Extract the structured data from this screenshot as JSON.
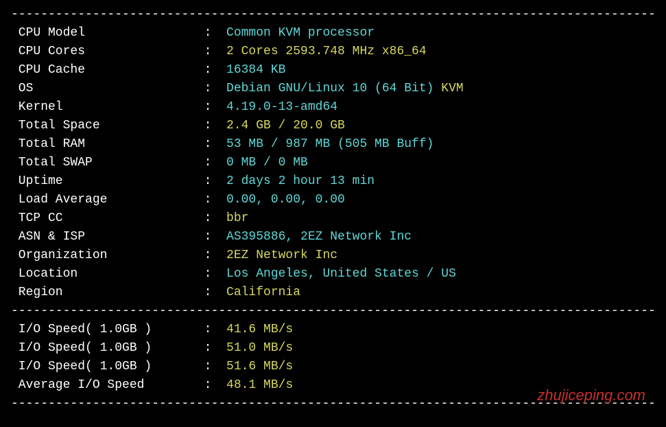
{
  "divider": "----------------------------------------------------------------------------------------------",
  "info": {
    "cpu_model": {
      "label": " CPU Model          ",
      "value": "Common KVM processor",
      "class": "val-cyan"
    },
    "cpu_cores": {
      "label": " CPU Cores          ",
      "value": "2 Cores 2593.748 MHz x86_64",
      "class": "val-yellow"
    },
    "cpu_cache": {
      "label": " CPU Cache          ",
      "value": "16384 KB",
      "class": "val-cyan"
    },
    "os": {
      "label": " OS                 ",
      "value1": "Debian GNU/Linux 10 (64 Bit) ",
      "value2": "KVM",
      "class1": "val-cyan",
      "class2": "val-yellow"
    },
    "kernel": {
      "label": " Kernel             ",
      "value": "4.19.0-13-amd64",
      "class": "val-cyan"
    },
    "total_space": {
      "label": " Total Space        ",
      "value": "2.4 GB / 20.0 GB",
      "class": "val-yellow"
    },
    "total_ram": {
      "label": " Total RAM          ",
      "value": "53 MB / 987 MB (505 MB Buff)",
      "class": "val-cyan"
    },
    "total_swap": {
      "label": " Total SWAP         ",
      "value": "0 MB / 0 MB",
      "class": "val-cyan"
    },
    "uptime": {
      "label": " Uptime             ",
      "value": "2 days 2 hour 13 min",
      "class": "val-cyan"
    },
    "load_avg": {
      "label": " Load Average       ",
      "value": "0.00, 0.00, 0.00",
      "class": "val-cyan"
    },
    "tcp_cc": {
      "label": " TCP CC             ",
      "value": "bbr",
      "class": "val-yellow"
    },
    "asn_isp": {
      "label": " ASN & ISP          ",
      "value": "AS395886, 2EZ Network Inc",
      "class": "val-cyan"
    },
    "organization": {
      "label": " Organization       ",
      "value": "2EZ Network Inc",
      "class": "val-yellow"
    },
    "location": {
      "label": " Location           ",
      "value": "Los Angeles, United States / US",
      "class": "val-cyan"
    },
    "region": {
      "label": " Region             ",
      "value": "California",
      "class": "val-yellow"
    }
  },
  "io": {
    "io1": {
      "label": " I/O Speed( 1.0GB ) ",
      "value": "41.6 MB/s",
      "class": "val-yellow"
    },
    "io2": {
      "label": " I/O Speed( 1.0GB ) ",
      "value": "51.0 MB/s",
      "class": "val-yellow"
    },
    "io3": {
      "label": " I/O Speed( 1.0GB ) ",
      "value": "51.6 MB/s",
      "class": "val-yellow"
    },
    "avg": {
      "label": " Average I/O Speed  ",
      "value": "48.1 MB/s",
      "class": "val-yellow"
    }
  },
  "colon": "  :  ",
  "watermark": "zhujiceping.com"
}
